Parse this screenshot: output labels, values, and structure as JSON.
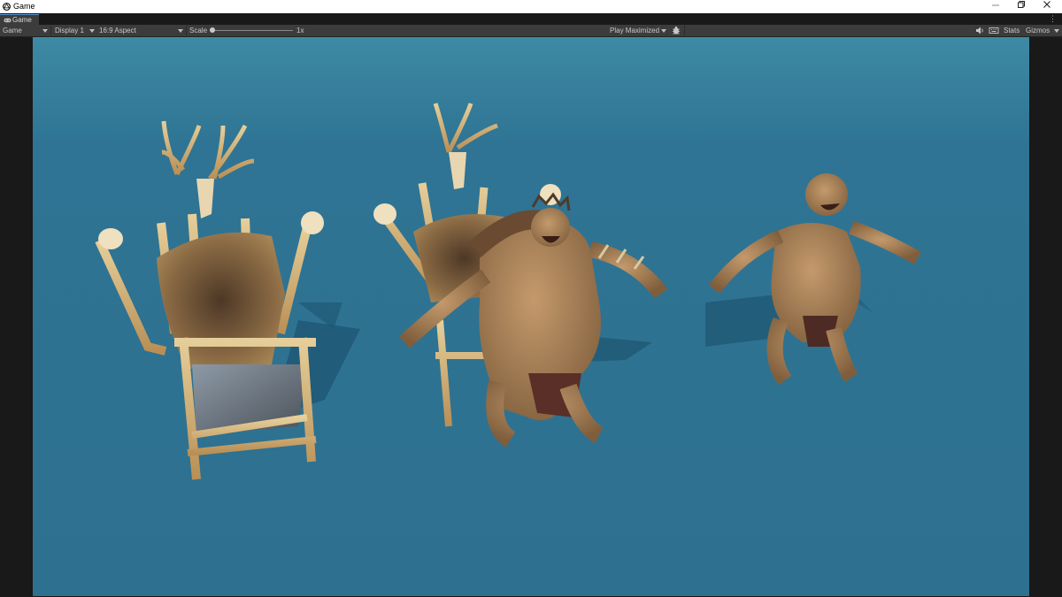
{
  "window": {
    "title": "Game",
    "controls": [
      "minimize",
      "restore",
      "close"
    ]
  },
  "tab": {
    "label": "Game",
    "icon": "gamepad-icon"
  },
  "toolbar": {
    "mode": "Game",
    "display": "Display 1",
    "aspect": "16:9 Aspect",
    "scale_label": "Scale",
    "scale_value": "1x",
    "play_mode": "Play Maximized",
    "stats": "Stats",
    "gizmos": "Gizmos",
    "icons": [
      "bug-icon",
      "speaker-icon",
      "keyboard-icon"
    ]
  },
  "viewport": {
    "background_color": "#2f7494",
    "objects": [
      "throne-chair",
      "throne-chair",
      "ogre-with-crown",
      "ogre"
    ]
  }
}
